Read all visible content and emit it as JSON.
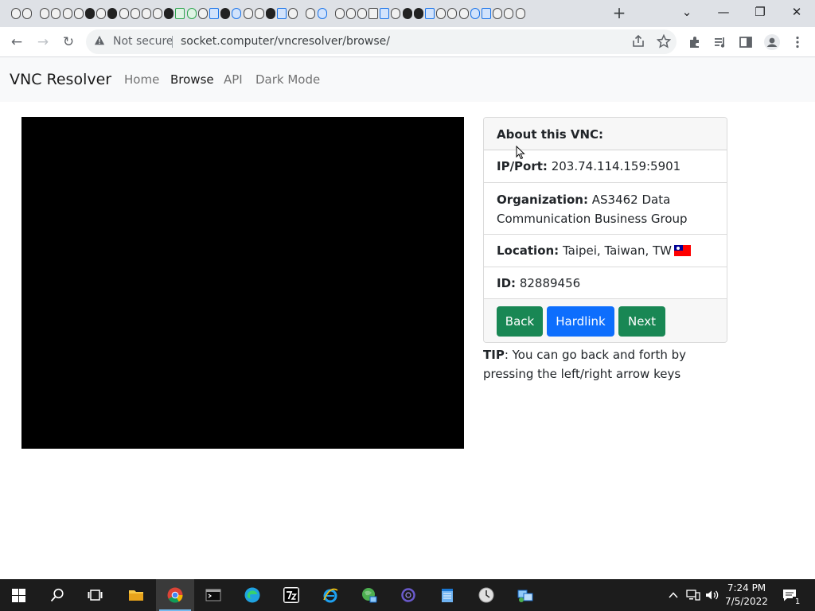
{
  "browser": {
    "tab_icons": [
      "favicon-1",
      "favicon-2",
      "favicon-3"
    ],
    "new_tab_label": "+",
    "controls": {
      "tab_search": "⌄",
      "minimize": "—",
      "restore": "❐",
      "close": "✕"
    },
    "toolbar": {
      "back": "←",
      "forward": "→",
      "reload": "↻"
    },
    "security_label": "Not secure",
    "url": "socket.computer/vncresolver/browse/"
  },
  "navbar": {
    "brand": "VNC Resolver",
    "links": [
      {
        "label": "Home"
      },
      {
        "label": "Browse"
      },
      {
        "label": "API"
      },
      {
        "label": "Dark Mode"
      }
    ]
  },
  "info_card": {
    "header": "About this VNC:",
    "ip_label": "IP/Port:",
    "ip_value": "203.74.114.159:5901",
    "org_label": "Organization:",
    "org_value": "AS3462 Data Communication Business Group",
    "location_label": "Location:",
    "location_value": "Taipei, Taiwan, TW",
    "id_label": "ID:",
    "id_value": "82889456",
    "buttons": {
      "back": "Back",
      "hardlink": "Hardlink",
      "next": "Next"
    }
  },
  "tip": {
    "label": "TIP",
    "text": ": You can go back and forth by pressing the left/right arrow keys"
  },
  "taskbar": {
    "time": "7:24 PM",
    "date": "7/5/2022",
    "notification_count": "1"
  },
  "colors": {
    "green_button": "#198754",
    "blue_button": "#0d6efd",
    "navbar_bg": "#f8f9fa",
    "taskbar_bg": "#1c1c1c"
  }
}
